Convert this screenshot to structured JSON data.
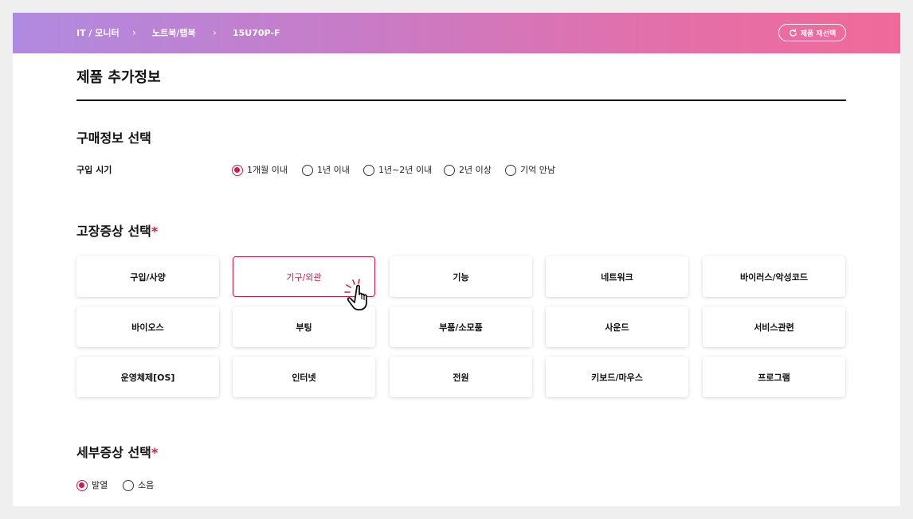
{
  "breadcrumb": {
    "items": [
      "IT / 모니터",
      "노트북/랩북",
      "15U70P-F"
    ],
    "separator": "›"
  },
  "reselect_button": {
    "label": "제품 재선택",
    "icon": "refresh-icon"
  },
  "page_title": "제품 추가정보",
  "purchase": {
    "section_title": "구매정보 선택",
    "row_label": "구입 시기",
    "options": [
      "1개월 이내",
      "1년 이내",
      "1년~2년 이내",
      "2년 이상",
      "기억 안남"
    ],
    "selected": "1개월 이내"
  },
  "symptom": {
    "section_title": "고장증상 선택",
    "required_mark": "*",
    "items": [
      "구입/사양",
      "기구/외관",
      "기능",
      "네트워크",
      "바이러스/악성코드",
      "바이오스",
      "부팅",
      "부품/소모품",
      "사운드",
      "서비스관련",
      "운영체제[OS]",
      "인터넷",
      "전원",
      "키보드/마우스",
      "프로그램"
    ],
    "selected": "기구/외관"
  },
  "detail": {
    "section_title": "세부증상 선택",
    "required_mark": "*",
    "options": [
      "발열",
      "소음"
    ],
    "selected": "발열"
  },
  "colors": {
    "accent": "#d21a4a",
    "gradient_start": "#b08ae0",
    "gradient_end": "#f06a99"
  },
  "cursor_icon": "hand-pointer-click-icon"
}
